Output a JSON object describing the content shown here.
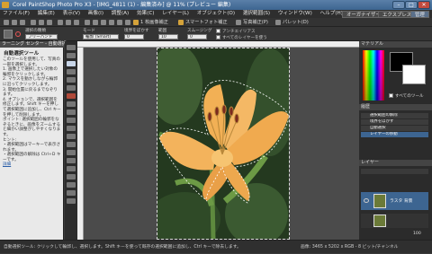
{
  "window": {
    "title": "Corel PaintShop Photo Pro X3 - [IMG_4811 (1) - 編集済み] @ 11% (プレビュー 編集)",
    "minimize": "–",
    "maximize": "□",
    "close": "✕"
  },
  "menu": {
    "items": [
      "ファイル(F)",
      "編集(E)",
      "表示(V)",
      "画像(I)",
      "調整(A)",
      "効果(C)",
      "レイヤー(L)",
      "オブジェクト(O)",
      "選択範囲(S)",
      "ウィンドウ(W)",
      "ヘルプ(H)"
    ],
    "workspace_button": "オーガナイザー",
    "express_button": "エクスプレスラボ",
    "manage_button": "管理"
  },
  "toolbar": {
    "items": [
      "1 枚画像補正",
      "スマートフォト補正",
      "写真補正(P)",
      "パレット(D)"
    ]
  },
  "options": {
    "mode_label": "選択の種類",
    "mode_value": "フリーハンド",
    "mode2_label": "モード",
    "mode2_value": "輪郭 (Smart)",
    "feather_label": "境界をぼかす",
    "feather_value": "0",
    "range_label": "範囲",
    "range_value": "10",
    "smooth_label": "スムージング",
    "smooth_value": "0",
    "antialias_label": "アンチエイリアス",
    "all_layers_label": "すべてのレイヤーを使う"
  },
  "learning_center": {
    "header": "ラーニング センター - 自動選択ツール",
    "title": "自動選択ツール",
    "steps": [
      "このツールを使用して、写真の一部を選択します。",
      "1. 画像上で選択したい対象の輪郭をクリックします。",
      "2. マウスを動かしながら輪郭に沿ってクリックします。",
      "3. 開始位置に戻るまでなぞります。",
      "4. オプションで、選択範囲を修正します。Shift キーを押して選択範囲に追加し、Ctrl キーを押して削除します。",
      "ポイント: 選択範囲の輪郭をなぞるときに、画像をズームすると細かい調整がしやすくなります。",
      "ヒント:",
      "・選択範囲はマーキーで表示されます。",
      "・選択範囲の解除は Ctrl+D キーです。",
      "詳細"
    ]
  },
  "right_panel": {
    "materials_header": "マテリアル",
    "all_tools_label": "すべてのツール",
    "overview_header": "履歴",
    "history_items": [
      "選択範囲の解除",
      "境界をぼかす",
      "自動選択",
      "レイヤーの移動"
    ],
    "layers_header": "レイヤー",
    "layer_name": "ラスタ 背景",
    "opacity_label": "100"
  },
  "status": {
    "left": "自動選択ツール: クリックして輪郭し、選択します。Shift キーを使って既存の選択範囲に追加し、Ctrl キーで除去します。",
    "right": "画像: 3465 x 5202 x RGB - 8 ビット/チャンネル"
  },
  "colors": {
    "accent": "#3d6591",
    "foreground_swatch": "#000000",
    "background_swatch": "#ffffff"
  }
}
